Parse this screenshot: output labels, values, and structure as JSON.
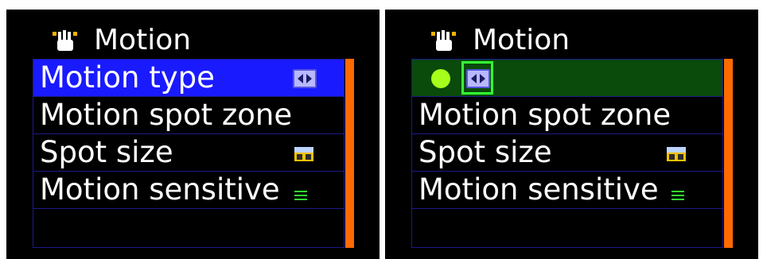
{
  "screens": [
    {
      "title": "Motion",
      "hand_icon": "hand-pointer-icon",
      "items": [
        {
          "label": "Motion type",
          "icon": "left-right-arrows-icon",
          "state": "highlighted"
        },
        {
          "label": "Motion spot zone"
        },
        {
          "label": "Spot size",
          "icon": "spot-size-icon"
        },
        {
          "label": "Motion sensitive",
          "icon": "sensitivity-bars-icon"
        },
        {
          "label": ""
        }
      ]
    },
    {
      "title": "Motion",
      "hand_icon": "hand-pointer-icon",
      "items": [
        {
          "label": "",
          "icon": "left-right-arrows-icon",
          "state": "editing",
          "indicator": "green-dot-icon"
        },
        {
          "label": "Motion spot zone"
        },
        {
          "label": "Spot size",
          "icon": "spot-size-icon"
        },
        {
          "label": "Motion sensitive",
          "icon": "sensitivity-bars-icon"
        },
        {
          "label": ""
        }
      ]
    }
  ],
  "colors": {
    "background": "#000000",
    "highlight_blue": "#1a1aff",
    "editing_green": "#0a4a0a",
    "indicator_green": "#a6ff1a",
    "scrollbar_orange": "#ff6a00",
    "row_border": "#1a1a8c"
  }
}
